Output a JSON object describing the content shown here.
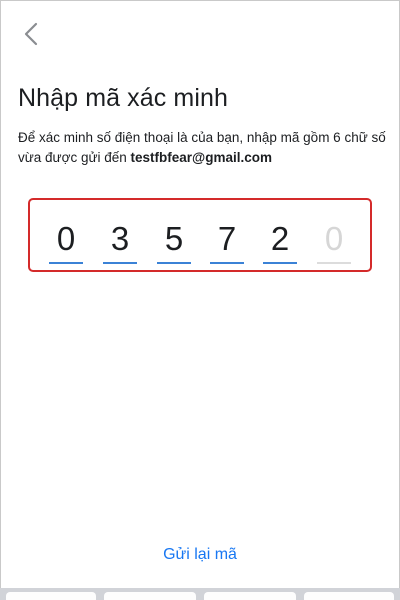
{
  "header": {
    "back_icon": "chevron-left-icon"
  },
  "main": {
    "title": "Nhập mã xác minh",
    "description_prefix": "Để xác minh số điện thoại là của bạn, nhập mã gồm 6 chữ số vừa được gửi đến ",
    "email": "testfbfear@gmail.com",
    "code_digits": [
      "0",
      "3",
      "5",
      "7",
      "2"
    ],
    "code_placeholder": "0",
    "resend_label": "Gửi lại mã"
  },
  "colors": {
    "accent": "#1877f2",
    "underline_active": "#3b82d6",
    "highlight_box": "#d42a2a"
  }
}
